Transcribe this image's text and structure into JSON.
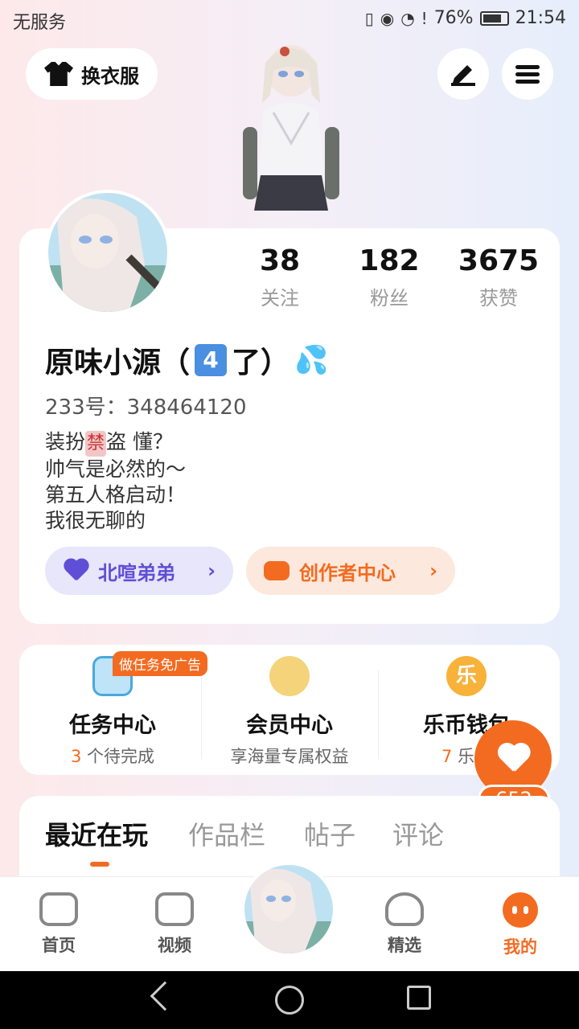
{
  "status_bar": {
    "carrier": "无服务",
    "battery": "76%",
    "time": "21:54"
  },
  "header": {
    "dress_label": "换衣服"
  },
  "profile": {
    "stats": [
      {
        "value": "38",
        "label": "关注"
      },
      {
        "value": "182",
        "label": "粉丝"
      },
      {
        "value": "3675",
        "label": "获赞"
      }
    ],
    "name_prefix": "原味小源（",
    "name_badge": "4",
    "name_suffix": "了）",
    "uid": "233号：348464120",
    "bio": [
      "装扮",
      "禁",
      "盗 懂？",
      "帅气是必然的～",
      "第五人格启动！",
      "我很无聊的"
    ],
    "pill_purple": "北喧弟弟",
    "pill_orange": "创作者中心"
  },
  "services": {
    "task_tag": "做任务免广告",
    "items": [
      {
        "title": "任务中心",
        "sub_num": "3",
        "sub_text": " 个待完成"
      },
      {
        "title": "会员中心",
        "sub_num": "",
        "sub_text": "享海量专属权益"
      },
      {
        "title": "乐币钱包",
        "sub_num": "7",
        "sub_text": " 乐币"
      }
    ],
    "coin_glyph": "乐"
  },
  "float": {
    "count": "652"
  },
  "tabs": [
    "最近在玩",
    "作品栏",
    "帖子",
    "评论"
  ],
  "bottom_nav": [
    {
      "label": "首页"
    },
    {
      "label": "视频"
    },
    {
      "label": "精选"
    },
    {
      "label": "我的"
    }
  ]
}
